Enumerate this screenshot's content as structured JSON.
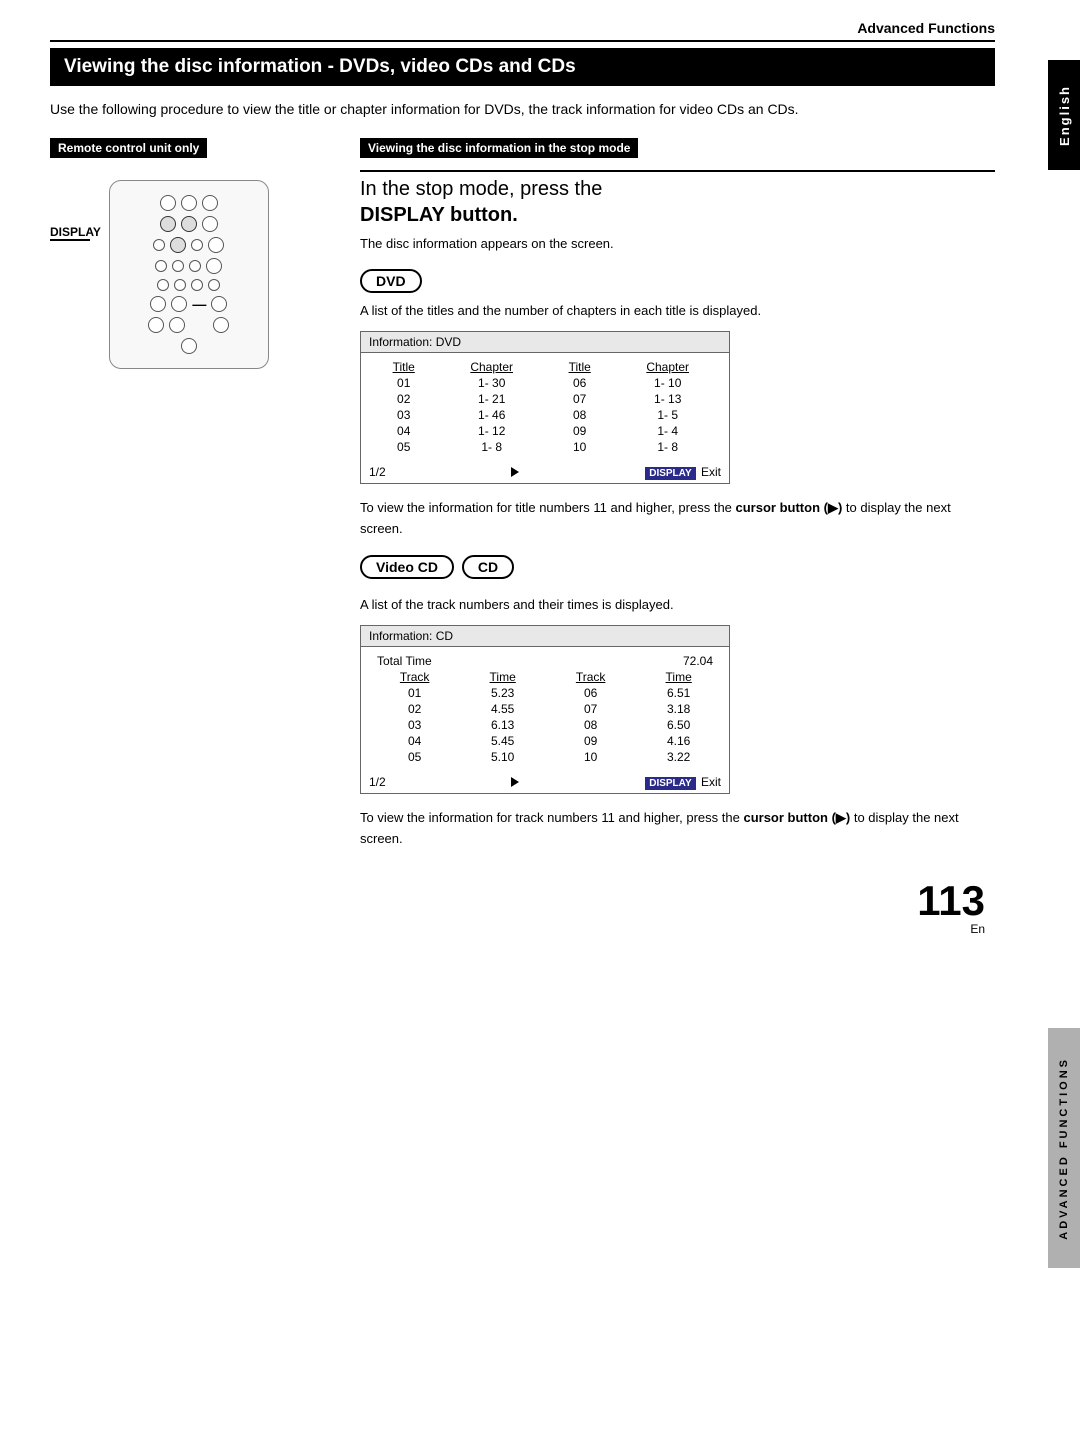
{
  "header": {
    "title": "Advanced Functions"
  },
  "section": {
    "title": "Viewing the disc information - DVDs, video CDs and CDs",
    "intro": "Use the following procedure to view the title or chapter information for DVDs, the track information for video CDs an CDs."
  },
  "left_column": {
    "box_label": "Remote control unit only",
    "display_label": "DISPLAY"
  },
  "right_column": {
    "stop_mode_label": "Viewing the disc information in the stop mode",
    "heading_1": "In the stop mode, press the",
    "heading_2": "DISPLAY button.",
    "disc_info_text": "The disc information appears on the screen.",
    "dvd_badge": "DVD",
    "dvd_desc": "A list of the titles and the number of chapters in each title is displayed.",
    "dvd_table": {
      "header": "Information: DVD",
      "columns": [
        "Title",
        "Chapter",
        "Title",
        "Chapter"
      ],
      "rows": [
        [
          "01",
          "1- 30",
          "06",
          "1- 10"
        ],
        [
          "02",
          "1- 21",
          "07",
          "1- 13"
        ],
        [
          "03",
          "1- 46",
          "08",
          "1- 5"
        ],
        [
          "04",
          "1- 12",
          "09",
          "1- 4"
        ],
        [
          "05",
          "1- 8",
          "10",
          "1- 8"
        ]
      ],
      "footer_page": "1/2",
      "footer_btn": "DISPLAY",
      "footer_exit": "Exit"
    },
    "cursor_text_1": "To view the information for title numbers 11 and higher, press the",
    "cursor_bold": "cursor button",
    "cursor_symbol": "(▶) to",
    "cursor_text_2": "display the next screen.",
    "videocd_badge": "Video CD",
    "cd_badge": "CD",
    "videocd_desc": "A list of the track numbers and their times is displayed.",
    "cd_table": {
      "header": "Information: CD",
      "total_time_label": "Total Time",
      "total_time_value": "72.04",
      "columns": [
        "Track",
        "Time",
        "Track",
        "Time"
      ],
      "rows": [
        [
          "01",
          "5.23",
          "06",
          "6.51"
        ],
        [
          "02",
          "4.55",
          "07",
          "3.18"
        ],
        [
          "03",
          "6.13",
          "08",
          "6.50"
        ],
        [
          "04",
          "5.45",
          "09",
          "4.16"
        ],
        [
          "05",
          "5.10",
          "10",
          "3.22"
        ]
      ],
      "footer_page": "1/2",
      "footer_btn": "DISPLAY",
      "footer_exit": "Exit"
    },
    "footer_text_1": "To view the information for track numbers 11 and higher, press the",
    "footer_bold": "cursor button (▶)",
    "footer_text_2": "to display the next screen."
  },
  "page_number": "113",
  "page_en": "En",
  "right_tab_top": "English",
  "right_tab_bottom": "ADVANCED FUNCTIONS"
}
